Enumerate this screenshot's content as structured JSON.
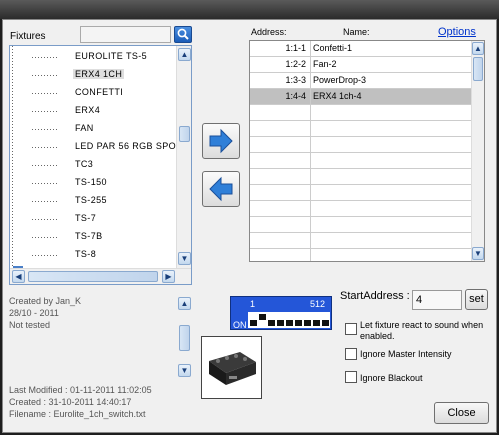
{
  "fixtures": {
    "label": "Fixtures",
    "search_value": "",
    "tree_items": [
      "EUROLITE TS-5",
      "ERX4 1CH",
      "CONFETTI",
      "ERX4",
      "FAN",
      "LED PAR 56 RGB SPO",
      "TC3",
      "TS-150",
      "TS-255",
      "TS-7",
      "TS-7B",
      "TS-8"
    ],
    "selected_index": 1
  },
  "info": {
    "lines": [
      "Created by Jan_K",
      "28/10 - 2011",
      "Not tested"
    ],
    "meta_lines": [
      "Last Modified : 01-11-2011 11:02:05",
      "Created : 31-10-2011 14:40:17",
      "Filename : Eurolite_1ch_switch.txt"
    ]
  },
  "patch": {
    "address_header": "Address:",
    "name_header": "Name:",
    "options_link": "Options",
    "rows": [
      {
        "address": "1:1-1",
        "name": "Confetti-1"
      },
      {
        "address": "1:2-2",
        "name": "Fan-2"
      },
      {
        "address": "1:3-3",
        "name": "PowerDrop-3"
      },
      {
        "address": "1:4-4",
        "name": "ERX4 1ch-4"
      }
    ],
    "selected_row": 3
  },
  "dip": {
    "start_num": "1",
    "end_num": "512",
    "on_label": "ON",
    "switches_on": [
      false,
      true,
      false,
      false,
      false,
      false,
      false,
      false,
      false
    ],
    "bg_color": "#2456d8"
  },
  "settings": {
    "start_address_label": "StartAddress :",
    "start_address_value": "4",
    "set_label": "set",
    "opt_sound": "Let fixture react to sound when enabled.",
    "opt_master": "Ignore Master Intensity",
    "opt_blackout": "Ignore Blackout",
    "close_label": "Close"
  },
  "colors": {
    "arrow_blue": "#2f7fd8",
    "link_blue": "#0033cc"
  }
}
